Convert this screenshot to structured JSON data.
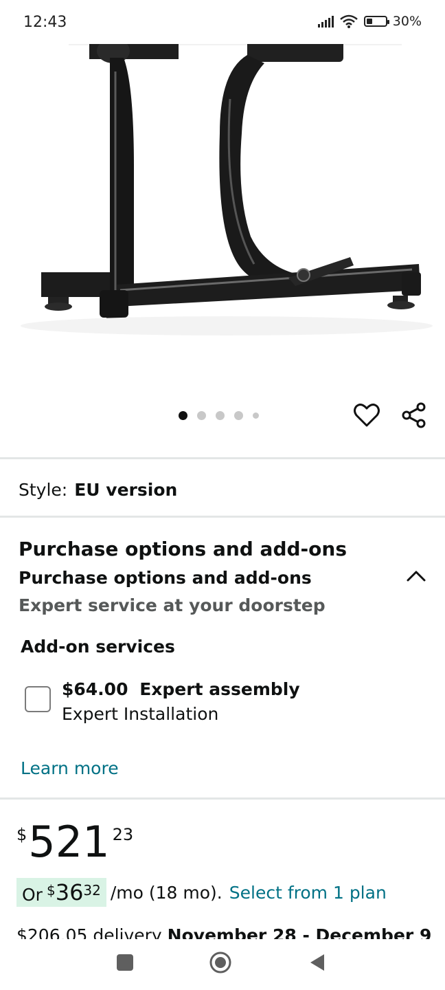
{
  "status": {
    "time": "12:43",
    "battery": "30%"
  },
  "gallery": {
    "dot_count": 5,
    "active_index": 0
  },
  "style": {
    "label": "Style:",
    "value": "EU version"
  },
  "purchase_options": {
    "title": "Purchase options and add-ons",
    "subtitle": "Purchase options and add-ons",
    "description": "Expert service at your doorstep"
  },
  "addon": {
    "heading": "Add-on services",
    "price": "$64.00",
    "name": "Expert assembly",
    "detail": "Expert Installation",
    "learn_more": "Learn more"
  },
  "price": {
    "currency": "$",
    "whole": "521",
    "fraction": "23"
  },
  "monthly": {
    "or": "Or",
    "currency": "$",
    "whole": "36",
    "fraction": "32",
    "term": "/mo (18 mo).",
    "select": "Select from 1 plan"
  },
  "delivery": {
    "fee": "$206.05 delivery",
    "dates": "November 28 - December 9"
  }
}
